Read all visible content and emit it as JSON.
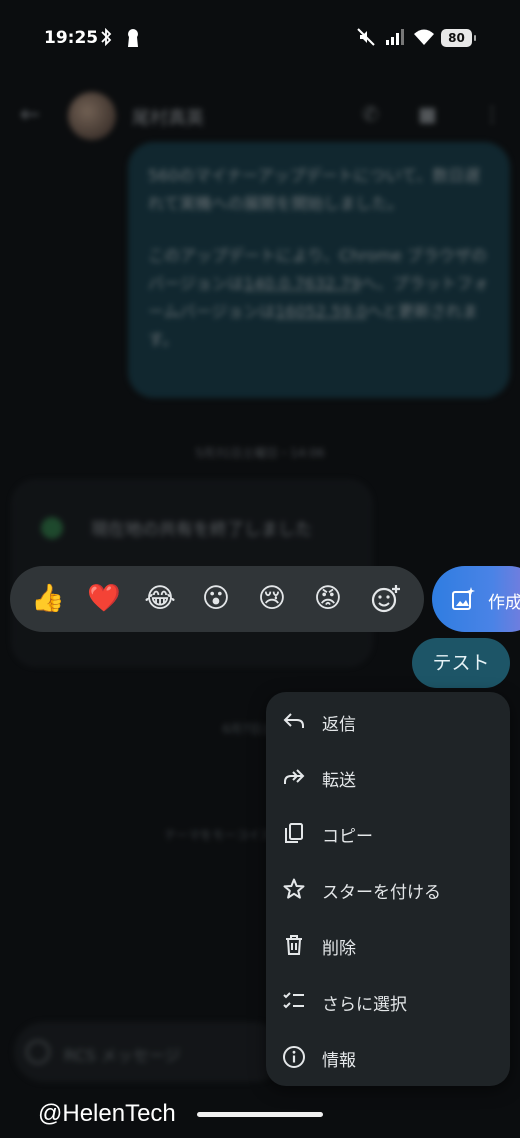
{
  "status_bar": {
    "time": "19:25",
    "battery": "80",
    "icons": [
      "bluetooth-icon",
      "keyhole-icon",
      "mute-icon",
      "signal-icon",
      "wifi-icon",
      "battery-icon"
    ]
  },
  "background_conversation": {
    "contact_name": "尾村真英",
    "message_paragraph_1": "560のマイナーアップデートについて、数日遅れて実機への展開を開始しました。",
    "message_paragraph_2_start": "このアップデートにより、Chrome ブラウザのバージョンは",
    "version_chrome": "140.0.7632.79",
    "message_paragraph_2_mid": "へ、プラットフォームバージョンは",
    "version_platform": "16052.59.0",
    "message_paragraph_2_end": "へと更新されます。",
    "timestamp_1": "5月31日土曜日・14:06",
    "location_text": "現在地の共有を終了しました",
    "timestamp_2": "6月7日土曜日",
    "system_message": "テーマをモーコイスに変更しました",
    "compose_placeholder": "RCS メッセージ"
  },
  "reactions": [
    {
      "emoji": "👍",
      "name": "thumbs-up"
    },
    {
      "emoji": "❤️",
      "name": "heart"
    },
    {
      "emoji": "😂",
      "name": "laughing"
    },
    {
      "emoji": "😮",
      "name": "surprised"
    },
    {
      "emoji": "😢",
      "name": "crying"
    },
    {
      "emoji": "😡",
      "name": "angry"
    }
  ],
  "compose_chip": {
    "label": "作成"
  },
  "selected_message": {
    "text": "テスト"
  },
  "context_menu": [
    {
      "label": "返信",
      "icon": "reply-icon"
    },
    {
      "label": "転送",
      "icon": "forward-icon"
    },
    {
      "label": "コピー",
      "icon": "copy-icon"
    },
    {
      "label": "スターを付ける",
      "icon": "star-icon"
    },
    {
      "label": "削除",
      "icon": "trash-icon"
    },
    {
      "label": "さらに選択",
      "icon": "checklist-icon"
    },
    {
      "label": "情報",
      "icon": "info-icon"
    }
  ],
  "watermark": "@HelenTech",
  "colors": {
    "background": "#0b0d0f",
    "menu_bg": "#1f2427",
    "reaction_bar_bg": "#303538",
    "sent_bubble": "#1d5567",
    "chip_gradient_start": "#2f7de1",
    "chip_gradient_end": "#8a7ad9"
  }
}
